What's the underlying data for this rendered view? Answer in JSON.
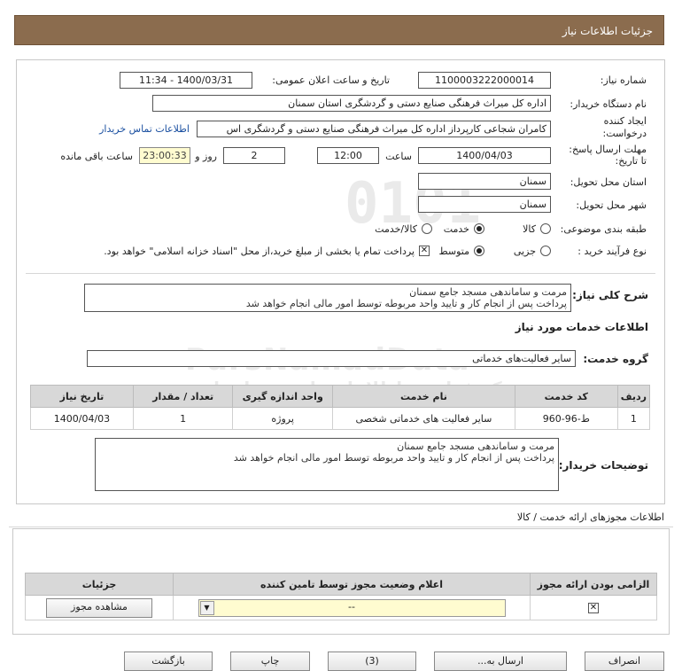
{
  "page_title": "جزئیات اطلاعات نیاز",
  "fields": {
    "need_number_label": "شماره نیاز:",
    "need_number": "1100003222000014",
    "announce_label": "تاریخ و ساعت اعلان عمومی:",
    "announce_value": "1400/03/31 - 11:34",
    "buyer_label": "نام دستگاه خریدار:",
    "buyer_value": "اداره کل میراث فرهنگی  صنایع دستی و گردشگری استان سمنان",
    "creator_label": "ایجاد کننده درخواست:",
    "creator_value": "کامران شجاعی کارپرداز اداره کل میراث فرهنگی  صنایع دستی و گردشگری اس",
    "contact_link": "اطلاعات تماس خریدار",
    "deadline_label": "مهلت ارسال پاسخ: تا تاریخ:",
    "deadline_date": "1400/04/03",
    "time_label": "ساعت",
    "deadline_time": "12:00",
    "days_value": "2",
    "days_label": "روز و",
    "remaining_value": "23:00:33",
    "remaining_label": "ساعت باقی مانده",
    "province_label": "استان محل تحویل:",
    "province_value": "سمنان",
    "city_label": "شهر محل تحویل:",
    "city_value": "سمنان",
    "category_label": "طبقه بندی موضوعی:",
    "category_options": [
      "کالا",
      "خدمت",
      "کالا/خدمت"
    ],
    "process_label": "نوع فرآیند خرید :",
    "process_options": [
      "جزیی",
      "متوسط"
    ],
    "payment_note": "پرداخت تمام یا بخشی از مبلغ خرید،از محل \"اسناد خزانه اسلامی\" خواهد بود."
  },
  "summary": {
    "label": "شرح کلی نیاز:",
    "line1": "مرمت و ساماندهی مسجد جامع سمنان",
    "line2": "پرداخت پس از انجام کار و تایید واحد مربوطه توسط امور مالی انجام خواهد شد"
  },
  "services_heading": "اطلاعات خدمات مورد نیاز",
  "service_group_label": "گروه خدمت:",
  "service_group_value": "سایر فعالیت‌های خدماتی",
  "table": {
    "headers": [
      "ردیف",
      "کد خدمت",
      "نام خدمت",
      "واحد اندازه گیری",
      "تعداد / مقدار",
      "تاریخ نیاز"
    ],
    "rows": [
      [
        "1",
        "ط-96-960",
        "سایر فعالیت های خدماتی شخصی",
        "پروژه",
        "1",
        "1400/04/03"
      ]
    ]
  },
  "buyer_notes": {
    "label": "توضیحات خریدار:",
    "line1": "مرمت و ساماندهی مسجد جامع سمنان",
    "line2": "پرداخت پس از انجام کار و تایید واحد مربوطه توسط امور مالی انجام خواهد شد"
  },
  "permits_heading": "اطلاعات مجوزهای ارائه خدمت / کالا",
  "permits_table": {
    "headers": [
      "الزامی بودن ارائه مجوز",
      "اعلام وضعیت مجوز توسط تامین کننده",
      "جزئیات"
    ],
    "select_value": "--",
    "view_button": "مشاهده مجوز"
  },
  "watermark": {
    "top": "0101",
    "brand": "ParsNamadData",
    "line1": "مرکز فراوری اطلاعات پارس نماد داده",
    "line2": "پایگاه اطلاع رسانی مناقصه ومزایده",
    "phone": "۰۲۱-۸۸۳۴۹۶۷۰"
  },
  "bottom_buttons": [
    "بازگشت",
    "چاپ",
    "(3)",
    "ارسال به...",
    "انصراف"
  ]
}
